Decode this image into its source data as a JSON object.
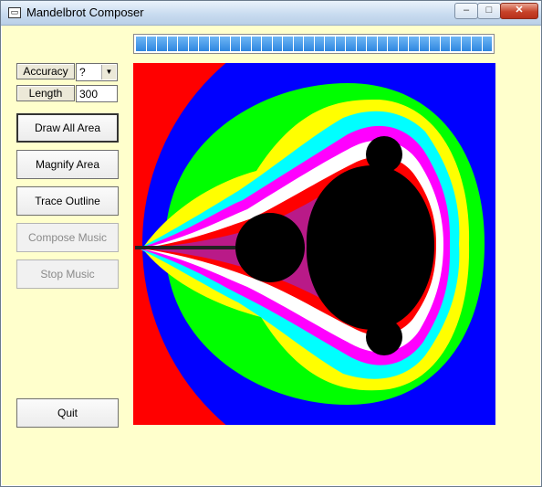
{
  "window": {
    "title": "Mandelbrot Composer",
    "min_glyph": "–",
    "max_glyph": "□",
    "close_glyph": "✕"
  },
  "controls": {
    "accuracy_label": "Accuracy",
    "accuracy_value": "?",
    "length_label": "Length",
    "length_value": "300"
  },
  "buttons": {
    "draw_all_area": "Draw All Area",
    "magnify_area": "Magnify Area",
    "trace_outline": "Trace Outline",
    "compose_music": "Compose Music",
    "stop_music": "Stop Music",
    "quit": "Quit"
  },
  "progress": {
    "segments": 34,
    "fraction": 1.0
  },
  "colors": {
    "background": "#ffffcc",
    "progress": "#2f86e0",
    "set": "#000000"
  }
}
